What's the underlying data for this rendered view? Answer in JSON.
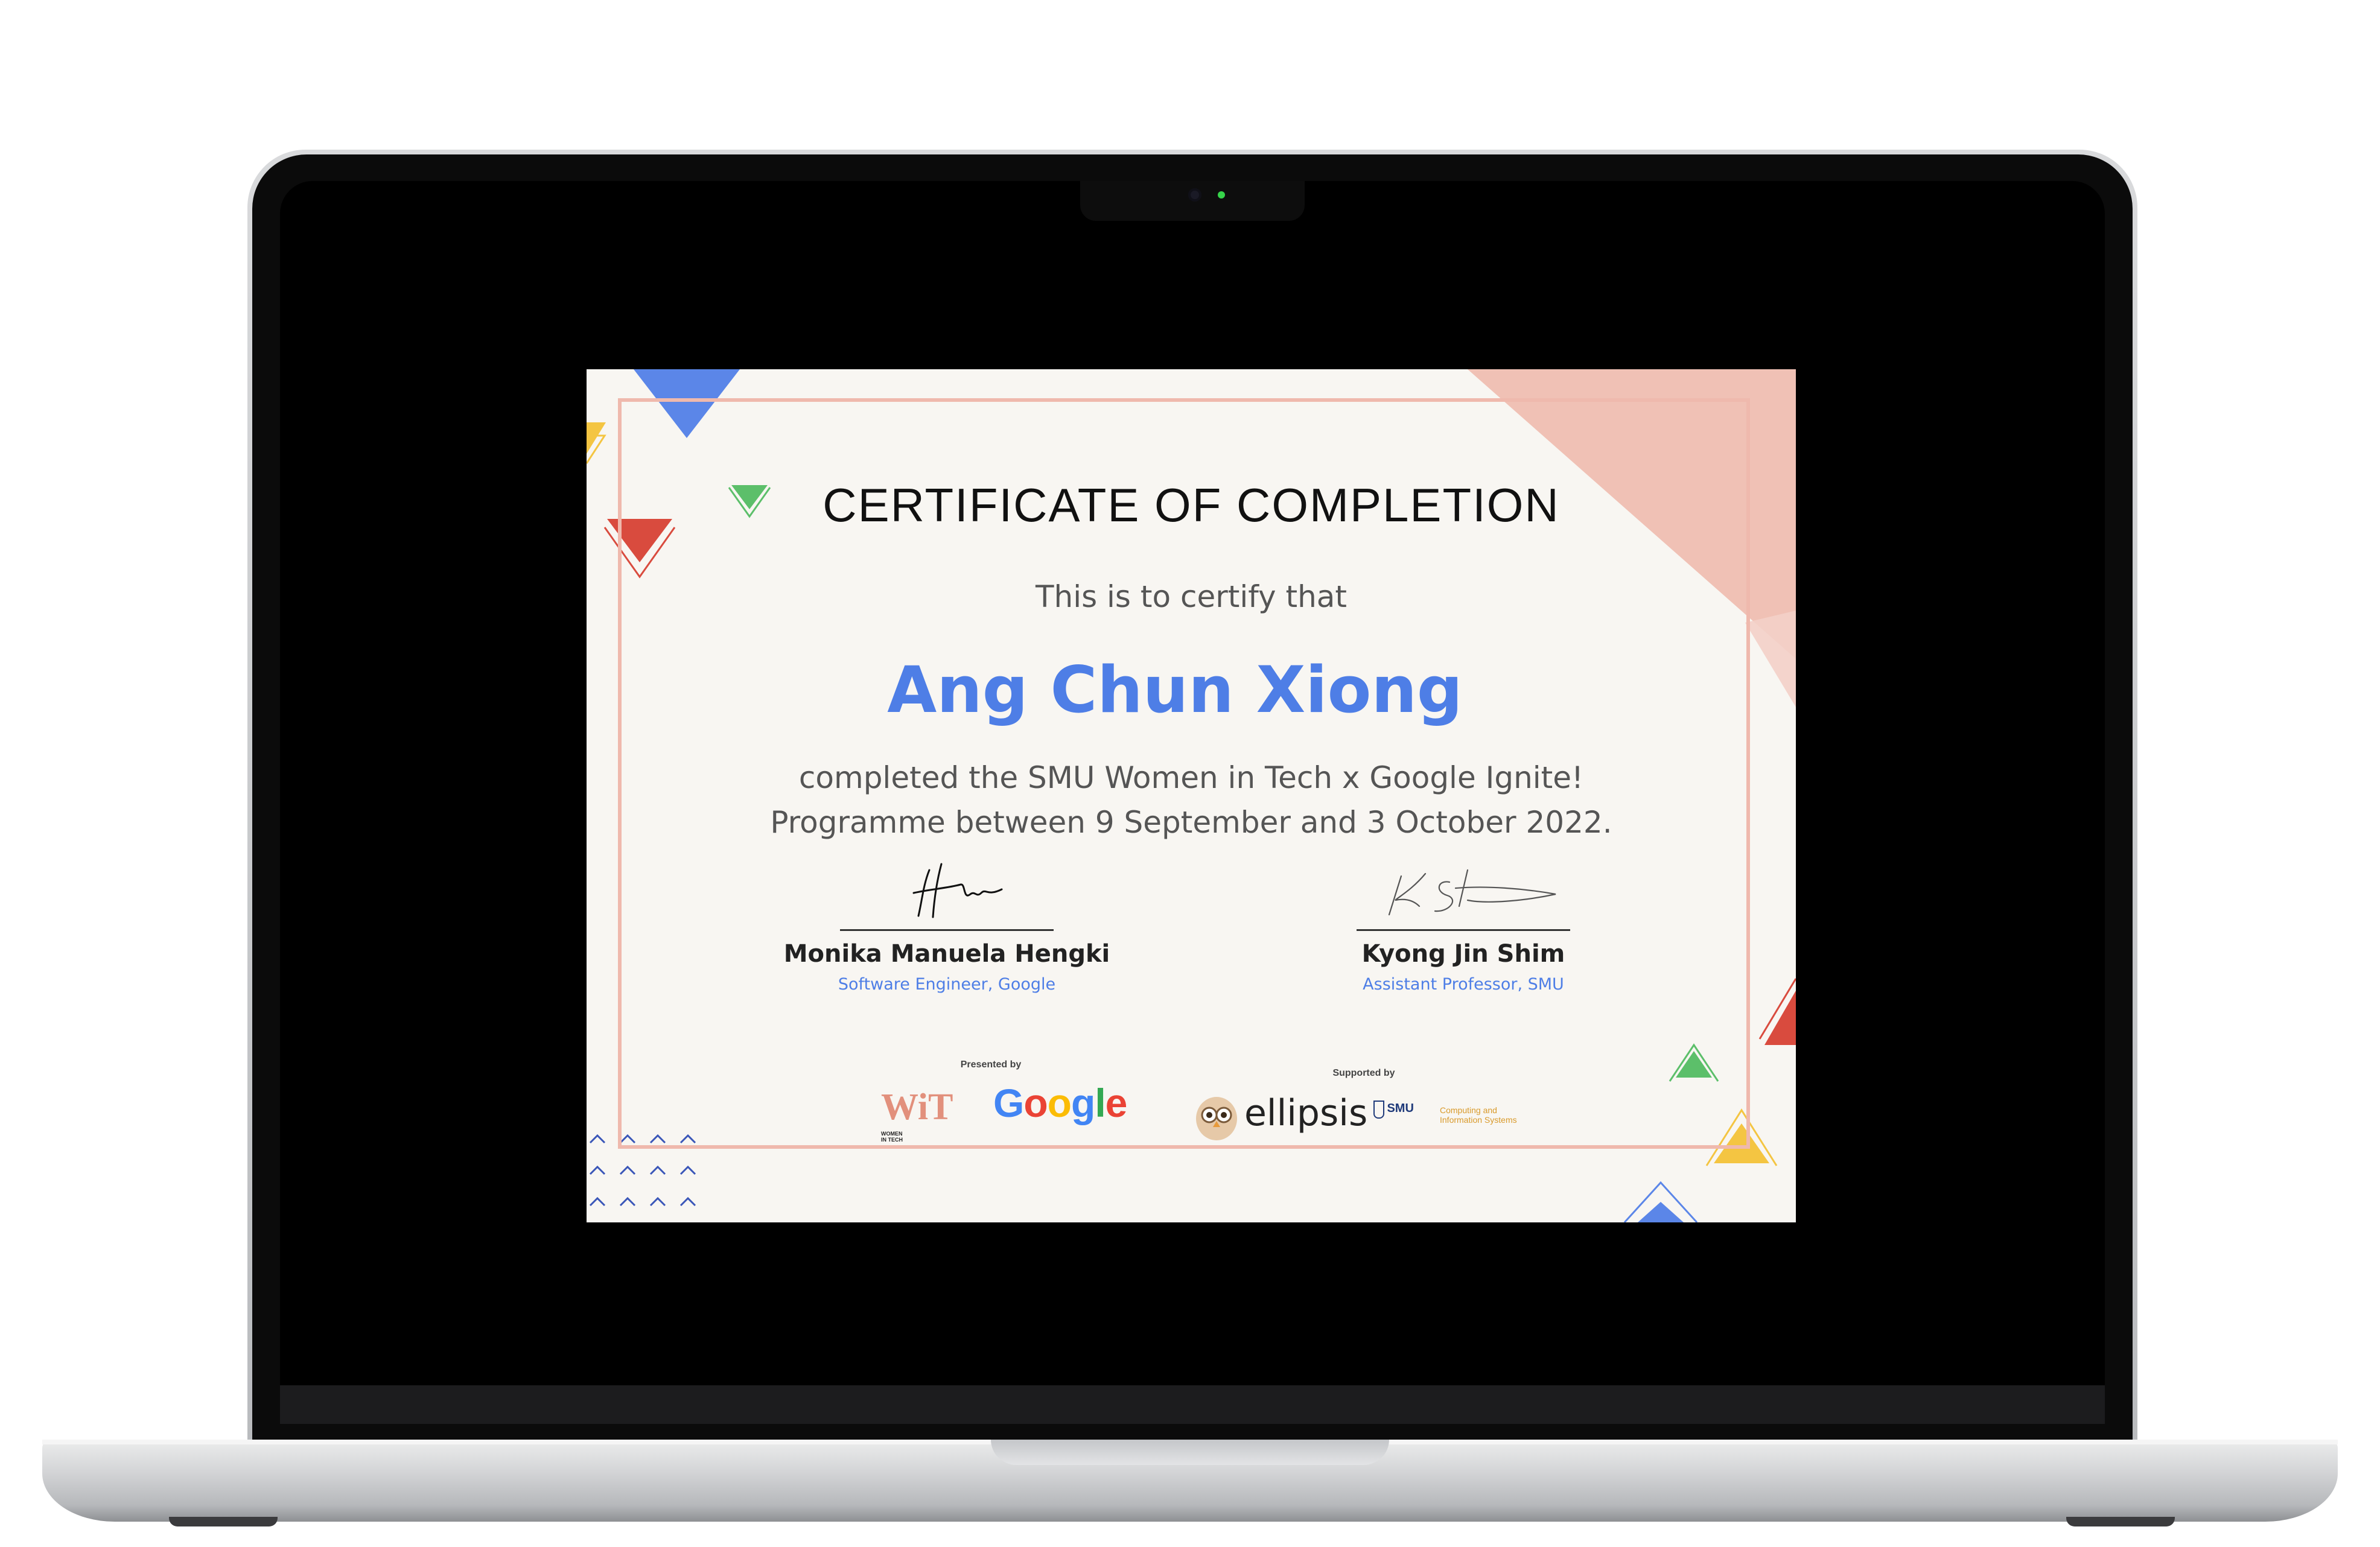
{
  "certificate": {
    "title": "CERTIFICATE OF COMPLETION",
    "subtitle": "This is to certify that",
    "recipient": "Ang Chun Xiong",
    "description_line1": "completed the SMU Women in Tech x Google Ignite!",
    "description_line2": "Programme between 9 September and 3 October 2022.",
    "signatories": [
      {
        "name": "Monika Manuela Hengki",
        "role": "Software Engineer, Google"
      },
      {
        "name": "Kyong Jin Shim",
        "role": "Assistant Professor, SMU"
      }
    ],
    "presented_by_label": "Presented by",
    "supported_by_label": "Supported by",
    "logos": {
      "wit_letters": "WiT",
      "wit_text": "WOMEN IN TECH",
      "google": "Google",
      "ellipsis": "ellipsis",
      "smu": "SMU",
      "scis": "Computing and Information Systems"
    }
  },
  "colors": {
    "accent_blue": "#4e7ee6",
    "google_blue": "#4285F4",
    "google_red": "#EA4335",
    "google_yellow": "#FBBC05",
    "google_green": "#34A853",
    "frame_pink": "#efb9ad"
  }
}
